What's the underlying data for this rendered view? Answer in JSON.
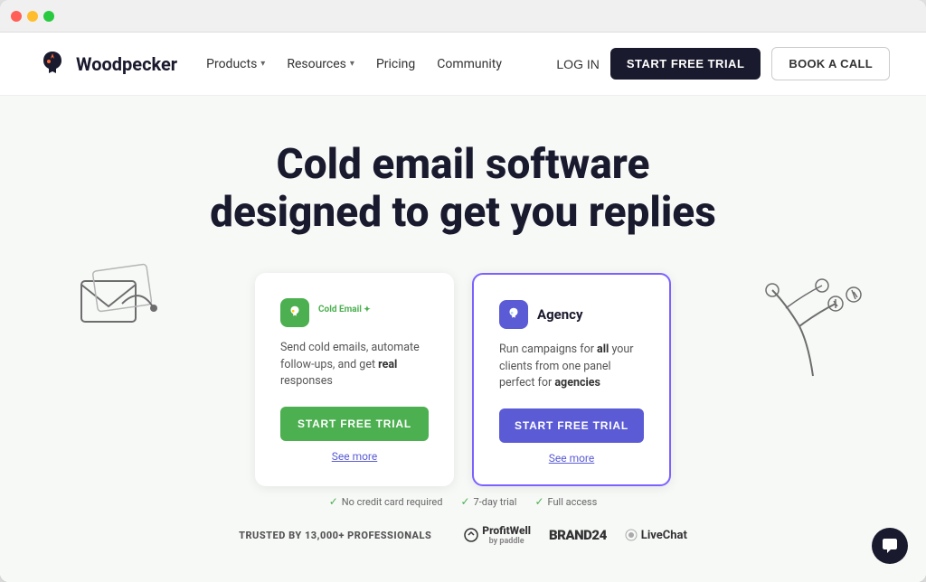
{
  "browser": {
    "traffic_lights": [
      "red",
      "yellow",
      "green"
    ]
  },
  "navbar": {
    "logo_text": "Woodpecker",
    "nav_items": [
      {
        "label": "Products",
        "has_dropdown": true
      },
      {
        "label": "Resources",
        "has_dropdown": true
      },
      {
        "label": "Pricing",
        "has_dropdown": false
      },
      {
        "label": "Community",
        "has_dropdown": false
      }
    ],
    "login_label": "LOG IN",
    "start_trial_label": "START FREE TRIAL",
    "book_call_label": "BOOK A CALL"
  },
  "hero": {
    "title_line1": "Cold email software",
    "title_line2": "designed to get you replies"
  },
  "card_cold_email": {
    "title": "Cold Email",
    "title_superscript": "✦",
    "description_parts": [
      "Send cold emails, automate follow-ups, and get ",
      "real",
      " responses"
    ],
    "btn_label": "START FREE TRIAL",
    "see_more": "See more"
  },
  "card_agency": {
    "title": "Agency",
    "description_parts": [
      "Run campaigns for ",
      "all",
      " your clients from one panel perfect for ",
      "agencies"
    ],
    "btn_label": "START FREE TRIAL",
    "see_more": "See more"
  },
  "trust_badges": [
    {
      "icon": "✓",
      "label": "No credit card required"
    },
    {
      "icon": "✓",
      "label": "7-day trial"
    },
    {
      "icon": "✓",
      "label": "Full access"
    }
  ],
  "trusted_by": "TRUSTED BY 13,000+ PROFESSIONALS",
  "brand_logos": [
    {
      "name": "ProfitWell",
      "sub": "by paddle"
    },
    {
      "name": "BRAND24"
    },
    {
      "name": "LiveChat"
    }
  ],
  "chat_icon": "💬"
}
